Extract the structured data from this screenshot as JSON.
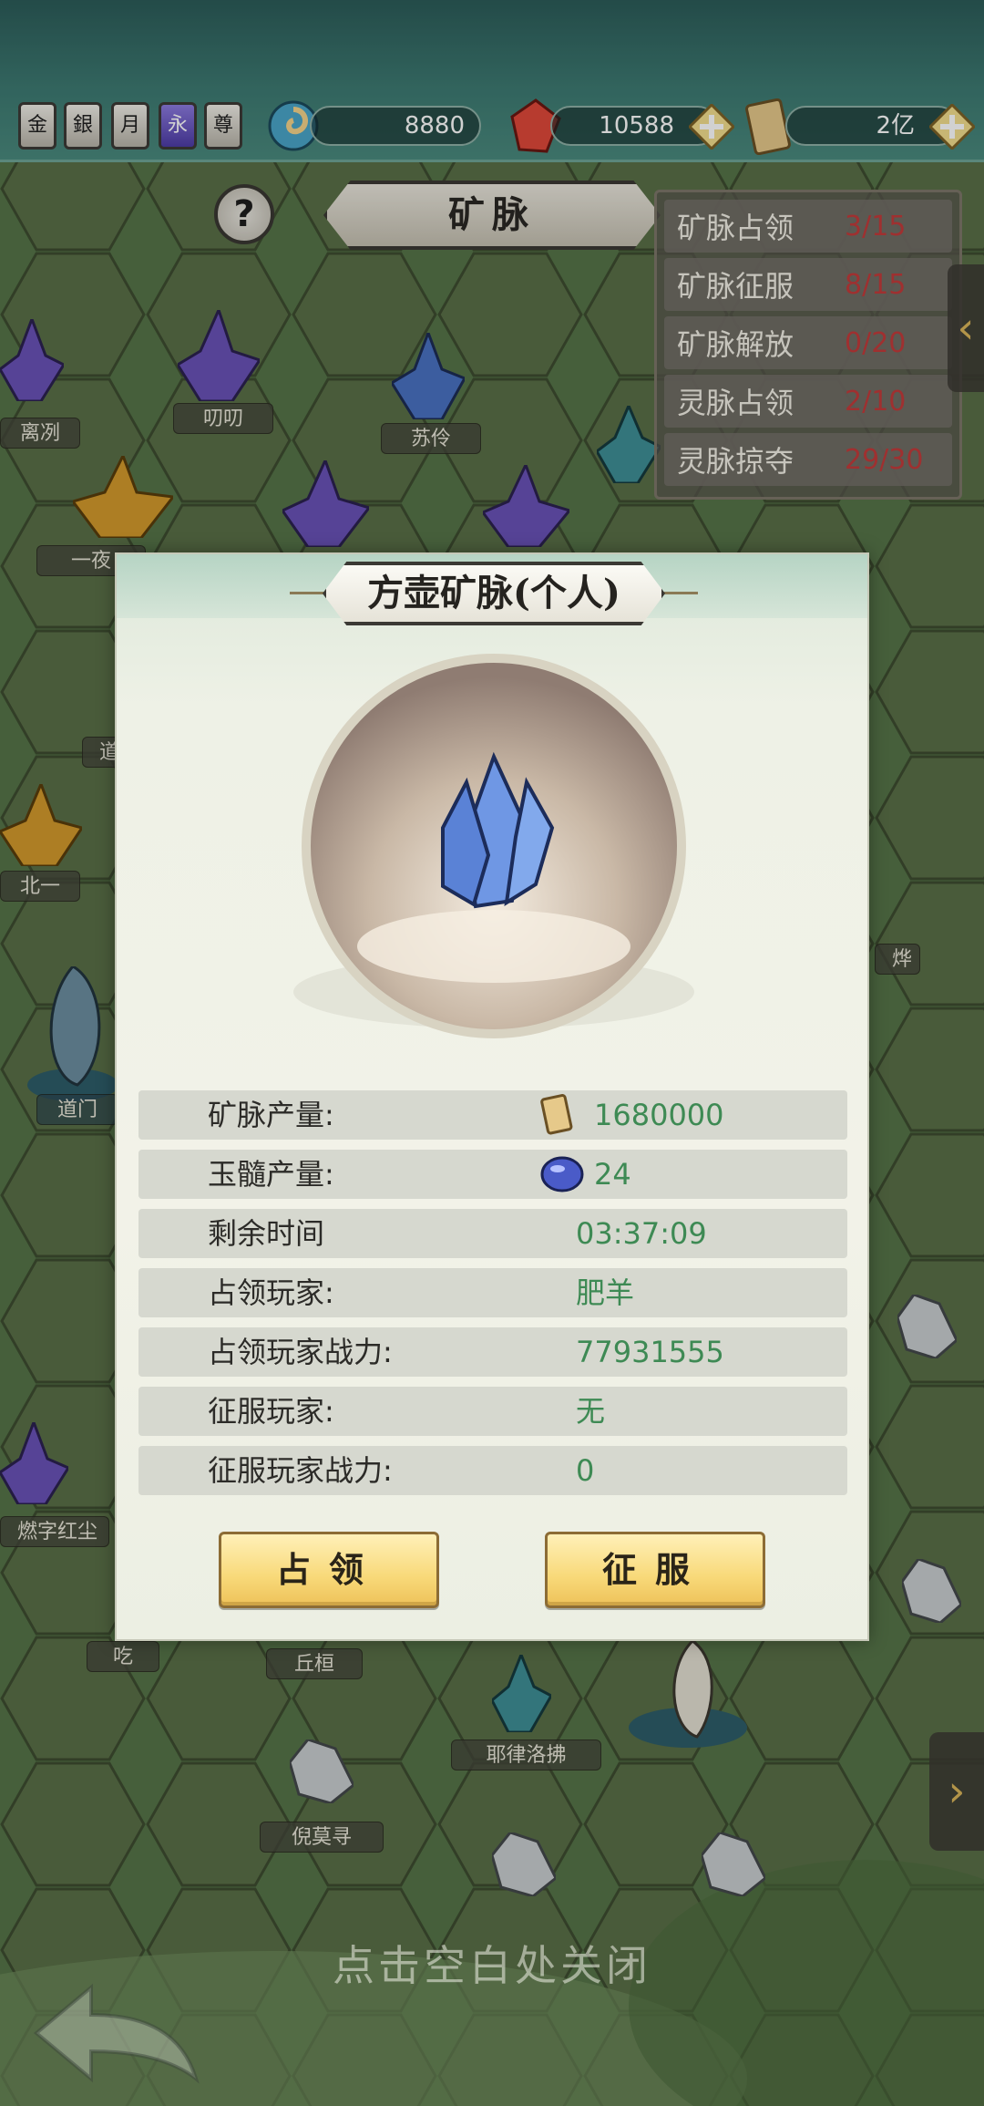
{
  "top_bar": {
    "rank_icons": [
      "金",
      "銀",
      "月",
      "永",
      "尊"
    ],
    "resources": [
      {
        "name": "swirl-currency",
        "value": "8880"
      },
      {
        "name": "red-gem",
        "value": "10588"
      },
      {
        "name": "scroll-ticket",
        "value": "2亿"
      }
    ]
  },
  "header": {
    "help": "?",
    "title": "矿脉"
  },
  "stats": [
    {
      "label": "矿脉占领",
      "value": "3/15"
    },
    {
      "label": "矿脉征服",
      "value": "8/15"
    },
    {
      "label": "矿脉解放",
      "value": "0/20"
    },
    {
      "label": "灵脉占领",
      "value": "2/10"
    },
    {
      "label": "灵脉掠夺",
      "value": "29/30"
    }
  ],
  "map_labels": [
    "离冽",
    "叨叨",
    "苏伶",
    "一夜",
    "道",
    "北一",
    "道门",
    "烨",
    "燃字红尘",
    "吃",
    "丘桓",
    "耶律洛拂",
    "倪莫寻"
  ],
  "modal": {
    "title": "方壶矿脉(个人)",
    "rows": [
      {
        "label": "矿脉产量:",
        "value": "1680000",
        "icon": "scroll-icon"
      },
      {
        "label": "玉髓产量:",
        "value": "24",
        "icon": "jade-icon"
      },
      {
        "label": "剩余时间",
        "value": "03:37:09"
      },
      {
        "label": "占领玩家:",
        "value": "肥羊"
      },
      {
        "label": "占领玩家战力:",
        "value": "77931555"
      },
      {
        "label": "征服玩家:",
        "value": "无"
      },
      {
        "label": "征服玩家战力:",
        "value": "0"
      }
    ],
    "occupy_label": "占领",
    "conquer_label": "征服"
  },
  "close_hint": "点击空白处关闭",
  "colors": {
    "stat_value": "#c23b3b",
    "info_value": "#3e8a54",
    "button": "#f8d979"
  }
}
